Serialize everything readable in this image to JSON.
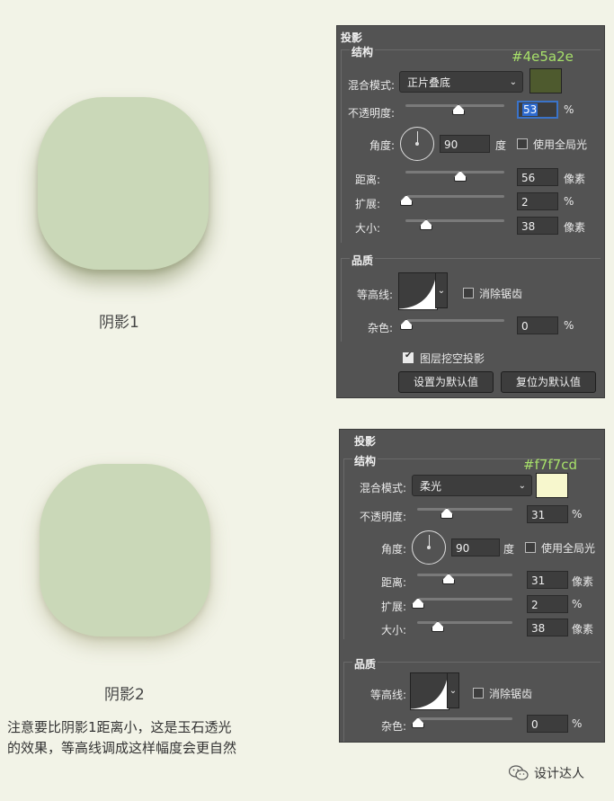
{
  "left": {
    "caption1": "阴影1",
    "caption2": "阴影2",
    "note_line1": "注意要比阴影1距离小，这是玉石透光",
    "note_line2": "的效果，等高线调成这样幅度会更自然",
    "watermark": "设计达人"
  },
  "panel1": {
    "title": "投影",
    "structure_label": "结构",
    "hex": "#4e5a2e",
    "swatch_color": "#4e5a2e",
    "blend_label": "混合模式:",
    "blend_value": "正片叠底",
    "opacity_label": "不透明度:",
    "opacity_value": "53",
    "opacity_fraction": 0.53,
    "percent": "%",
    "angle_label": "角度:",
    "angle_value": "90",
    "degree": "度",
    "global_light": "使用全局光",
    "distance_label": "距离:",
    "distance_value": "56",
    "spread_label": "扩展:",
    "spread_value": "2",
    "size_label": "大小:",
    "size_value": "38",
    "px": "像素",
    "quality_label": "品质",
    "contour_label": "等高线:",
    "antialias": "消除锯齿",
    "noise_label": "杂色:",
    "noise_value": "0",
    "knockout": "图层挖空投影",
    "set_default": "设置为默认值",
    "reset_default": "复位为默认值"
  },
  "panel2": {
    "title": "投影",
    "structure_label": "结构",
    "hex": "#f7f7cd",
    "swatch_color": "#f7f7cd",
    "blend_label": "混合模式:",
    "blend_value": "柔光",
    "opacity_label": "不透明度:",
    "opacity_value": "31",
    "percent": "%",
    "angle_label": "角度:",
    "angle_value": "90",
    "degree": "度",
    "global_light": "使用全局光",
    "distance_label": "距离:",
    "distance_value": "31",
    "spread_label": "扩展:",
    "spread_value": "2",
    "size_label": "大小:",
    "size_value": "38",
    "px": "像素",
    "quality_label": "品质",
    "contour_label": "等高线:",
    "antialias": "消除锯齿",
    "noise_label": "杂色:",
    "noise_value": "0"
  }
}
